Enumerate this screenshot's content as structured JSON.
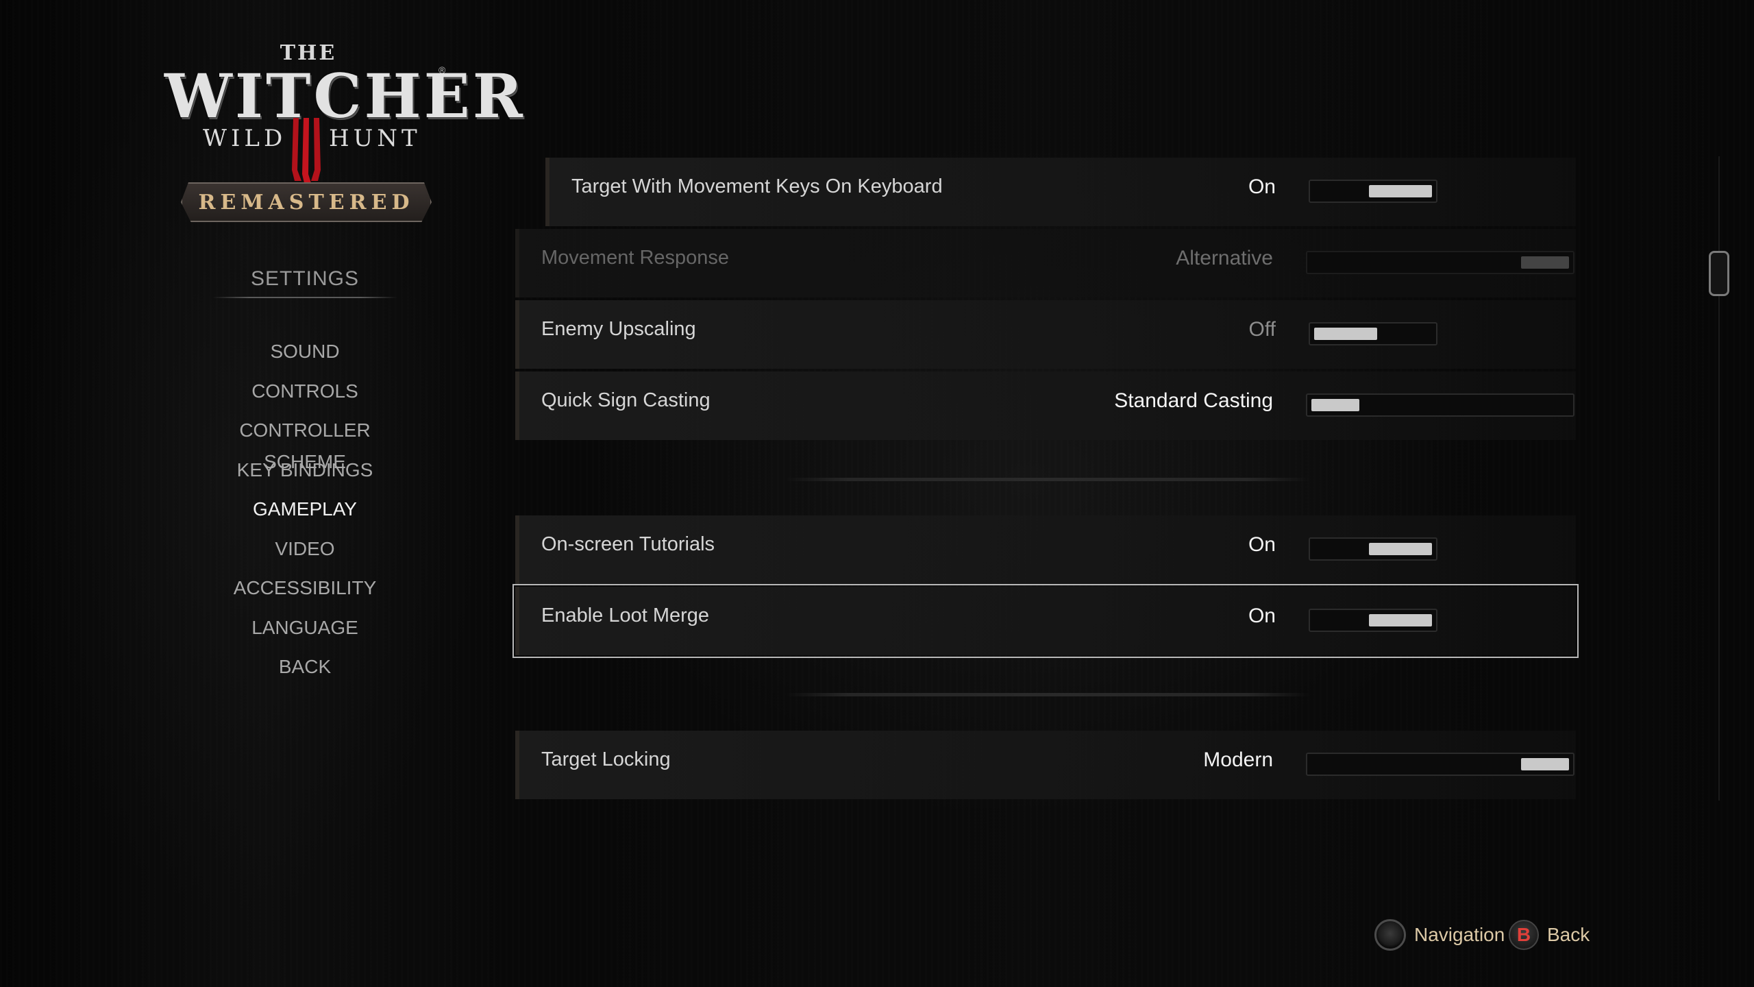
{
  "logo": {
    "the": "THE",
    "witcher": "WITCHER",
    "registered": "®",
    "wild": "WILD",
    "hunt": "HUNT",
    "remastered": "REMASTERED"
  },
  "menu": {
    "title": "SETTINGS",
    "items": [
      {
        "label": "SOUND",
        "active": false
      },
      {
        "label": "CONTROLS",
        "active": false
      },
      {
        "label": "CONTROLLER SCHEME",
        "active": false
      },
      {
        "label": "KEY BINDINGS",
        "active": false
      },
      {
        "label": "GAMEPLAY",
        "active": true
      },
      {
        "label": "VIDEO",
        "active": false
      },
      {
        "label": "ACCESSIBILITY",
        "active": false
      },
      {
        "label": "LANGUAGE",
        "active": false
      },
      {
        "label": "BACK",
        "active": false
      }
    ]
  },
  "settings": [
    {
      "label": "Target With Movement Keys On Keyboard",
      "value": "On",
      "control": "toggle",
      "level": 1,
      "dim": false,
      "focused": false,
      "indented": true
    },
    {
      "label": "Movement Response",
      "value": "Alternative",
      "control": "slider",
      "level": 1,
      "dim": true,
      "focused": false,
      "indented": false
    },
    {
      "label": "Enemy Upscaling",
      "value": "Off",
      "control": "toggle",
      "level": 0,
      "dim": false,
      "focused": false,
      "indented": false
    },
    {
      "label": "Quick Sign Casting",
      "value": "Standard Casting",
      "control": "slider",
      "level": 0,
      "dim": false,
      "focused": false,
      "indented": false
    },
    {
      "label": "On-screen Tutorials",
      "value": "On",
      "control": "toggle",
      "level": 1,
      "dim": false,
      "focused": false,
      "indented": false
    },
    {
      "label": "Enable Loot Merge",
      "value": "On",
      "control": "toggle",
      "level": 1,
      "dim": false,
      "focused": true,
      "indented": false
    },
    {
      "label": "Target Locking",
      "value": "Modern",
      "control": "slider",
      "level": 1,
      "dim": false,
      "focused": false,
      "indented": false
    }
  ],
  "footer": {
    "navigation_label": "Navigation",
    "back_button": "B",
    "back_label": "Back"
  },
  "colors": {
    "accent_gold": "#dcc9a6",
    "back_button_red": "#e0403a",
    "active_menu": "#f2f2f2",
    "menu_text": "#a8a8a8"
  }
}
